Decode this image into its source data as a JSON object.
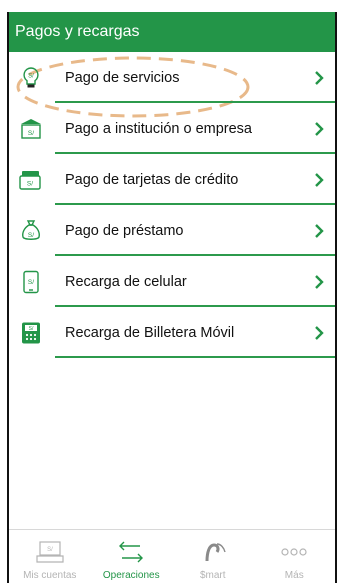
{
  "header": {
    "title": "Pagos y recargas"
  },
  "menu": {
    "items": [
      {
        "label": "Pago de servicios",
        "icon": "lightbulb-icon"
      },
      {
        "label": "Pago a institución o empresa",
        "icon": "institution-icon"
      },
      {
        "label": "Pago de tarjetas de crédito",
        "icon": "credit-card-icon"
      },
      {
        "label": "Pago de préstamo",
        "icon": "money-bag-icon"
      },
      {
        "label": "Recarga de celular",
        "icon": "mobile-phone-icon"
      },
      {
        "label": "Recarga de Billetera Móvil",
        "icon": "wallet-calculator-icon"
      }
    ]
  },
  "bottom_nav": {
    "tabs": [
      {
        "label": "Mis cuentas",
        "icon": "accounts-icon",
        "active": false
      },
      {
        "label": "Operaciones",
        "icon": "transfer-arrows-icon",
        "active": true
      },
      {
        "label": "$mart",
        "icon": "smart-icon",
        "active": false
      },
      {
        "label": "Más",
        "icon": "more-dots-icon",
        "active": false
      }
    ]
  },
  "colors": {
    "accent": "#239548",
    "highlight": "#e8b98a",
    "inactive": "#b4b4b4"
  }
}
